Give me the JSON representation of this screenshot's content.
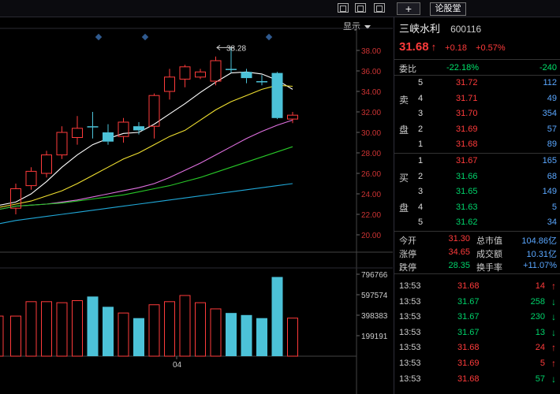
{
  "toolbar": {
    "display_label": "显示",
    "tab_label": "论股堂",
    "plus_label": "+"
  },
  "stock": {
    "name": "三峡水利",
    "code": "600116",
    "price": "31.68",
    "change": "+0.18",
    "change_pct": "+0.57%"
  },
  "weibi": {
    "label": "委比",
    "pct": "-22.18%",
    "diff": "-240"
  },
  "sell": {
    "side_label_top": "卖",
    "side_label_bottom": "盘",
    "rows": [
      {
        "n": "5",
        "price": "31.72",
        "qty": "112"
      },
      {
        "n": "4",
        "price": "31.71",
        "qty": "49"
      },
      {
        "n": "3",
        "price": "31.70",
        "qty": "354"
      },
      {
        "n": "2",
        "price": "31.69",
        "qty": "57"
      },
      {
        "n": "1",
        "price": "31.68",
        "qty": "89"
      }
    ]
  },
  "buy": {
    "side_label_top": "买",
    "side_label_bottom": "盘",
    "rows": [
      {
        "n": "1",
        "price": "31.67",
        "qty": "165"
      },
      {
        "n": "2",
        "price": "31.66",
        "qty": "68"
      },
      {
        "n": "3",
        "price": "31.65",
        "qty": "149"
      },
      {
        "n": "4",
        "price": "31.63",
        "qty": "5"
      },
      {
        "n": "5",
        "price": "31.62",
        "qty": "34"
      }
    ]
  },
  "stats": [
    {
      "k1": "今开",
      "v1": "31.30",
      "k2": "总市值",
      "v2": "104.86亿"
    },
    {
      "k1": "涨停",
      "v1": "34.65",
      "k2": "成交额",
      "v2": "10.31亿"
    },
    {
      "k1": "跌停",
      "v1": "28.35",
      "k2": "换手率",
      "v2": "+11.07%"
    }
  ],
  "ticks": [
    {
      "time": "13:53",
      "price": "31.68",
      "qty": "14",
      "dir": "up"
    },
    {
      "time": "13:53",
      "price": "31.67",
      "qty": "258",
      "dir": "down"
    },
    {
      "time": "13:53",
      "price": "31.67",
      "qty": "230",
      "dir": "down"
    },
    {
      "time": "13:53",
      "price": "31.67",
      "qty": "13",
      "dir": "down"
    },
    {
      "time": "13:53",
      "price": "31.68",
      "qty": "24",
      "dir": "up"
    },
    {
      "time": "13:53",
      "price": "31.69",
      "qty": "5",
      "dir": "up"
    },
    {
      "time": "13:53",
      "price": "31.68",
      "qty": "57",
      "dir": "down"
    }
  ],
  "chart_data": [
    {
      "type": "candlestick",
      "title": "",
      "price_axis_labels": [
        "38.00",
        "36.00",
        "34.00",
        "32.00",
        "30.00",
        "28.00",
        "26.00",
        "24.00",
        "22.00",
        "20.00"
      ],
      "ylim": [
        20,
        38
      ],
      "max_annotation": "38.28",
      "candles": [
        {
          "o": 22.6,
          "c": 24.5,
          "h": 25.0,
          "l": 22.0,
          "color": "red"
        },
        {
          "o": 24.8,
          "c": 26.2,
          "h": 26.6,
          "l": 24.4,
          "color": "red"
        },
        {
          "o": 26.0,
          "c": 27.8,
          "h": 28.2,
          "l": 25.6,
          "color": "red"
        },
        {
          "o": 27.8,
          "c": 30.0,
          "h": 30.6,
          "l": 27.4,
          "color": "red"
        },
        {
          "o": 29.5,
          "c": 30.4,
          "h": 31.6,
          "l": 28.8,
          "color": "red"
        },
        {
          "o": 30.6,
          "c": 30.6,
          "h": 32.0,
          "l": 29.4,
          "color": "cyan"
        },
        {
          "o": 30.0,
          "c": 29.1,
          "h": 30.8,
          "l": 28.8,
          "color": "cyan"
        },
        {
          "o": 29.6,
          "c": 31.0,
          "h": 31.4,
          "l": 29.0,
          "color": "red"
        },
        {
          "o": 30.6,
          "c": 30.2,
          "h": 31.0,
          "l": 29.8,
          "color": "cyan"
        },
        {
          "o": 30.6,
          "c": 33.6,
          "h": 33.8,
          "l": 29.4,
          "color": "red"
        },
        {
          "o": 34.0,
          "c": 35.4,
          "h": 36.2,
          "l": 33.2,
          "color": "red"
        },
        {
          "o": 35.2,
          "c": 36.4,
          "h": 36.6,
          "l": 34.4,
          "color": "red"
        },
        {
          "o": 35.4,
          "c": 35.9,
          "h": 36.2,
          "l": 35.2,
          "color": "red"
        },
        {
          "o": 35.0,
          "c": 37.0,
          "h": 37.4,
          "l": 34.6,
          "color": "red"
        },
        {
          "o": 36.2,
          "c": 36.2,
          "h": 38.28,
          "l": 35.8,
          "color": "cyan"
        },
        {
          "o": 35.9,
          "c": 35.3,
          "h": 36.2,
          "l": 34.8,
          "color": "cyan"
        },
        {
          "o": 35.0,
          "c": 35.0,
          "h": 35.6,
          "l": 34.6,
          "color": "cyan"
        },
        {
          "o": 35.8,
          "c": 31.4,
          "h": 35.9,
          "l": 31.3,
          "color": "cyan"
        },
        {
          "o": 31.3,
          "c": 31.68,
          "h": 32.0,
          "l": 30.9,
          "color": "red"
        }
      ],
      "ma": [
        {
          "name": "MA5",
          "color": "#ffffff",
          "values": [
            23.2,
            24.0,
            25.2,
            26.6,
            27.8,
            28.8,
            29.4,
            29.9,
            30.0,
            30.8,
            31.8,
            32.8,
            33.9,
            34.9,
            35.8,
            35.9,
            35.7,
            35.1,
            34.2
          ]
        },
        {
          "name": "MA10",
          "color": "#f0e030",
          "values": [
            23.0,
            23.3,
            23.8,
            24.3,
            25.0,
            25.8,
            26.6,
            27.4,
            28.0,
            28.8,
            29.6,
            30.2,
            31.2,
            32.2,
            33.0,
            33.6,
            34.2,
            34.6,
            34.5
          ]
        },
        {
          "name": "MA20",
          "color": "#e070e0",
          "values": [
            22.8,
            22.9,
            23.0,
            23.2,
            23.4,
            23.7,
            24.0,
            24.3,
            24.6,
            25.0,
            25.6,
            26.3,
            27.0,
            27.8,
            28.6,
            29.4,
            30.1,
            30.7,
            31.2
          ]
        },
        {
          "name": "MA30",
          "color": "#28c828",
          "values": [
            22.8,
            22.9,
            23.0,
            23.1,
            23.3,
            23.5,
            23.7,
            23.9,
            24.2,
            24.5,
            24.8,
            25.2,
            25.6,
            26.1,
            26.6,
            27.1,
            27.6,
            28.1,
            28.6
          ]
        },
        {
          "name": "MA60",
          "color": "#20a8d8",
          "values": [
            21.4,
            21.6,
            21.8,
            22.0,
            22.2,
            22.4,
            22.6,
            22.8,
            23.0,
            23.2,
            23.4,
            23.6,
            23.8,
            24.0,
            24.2,
            24.4,
            24.6,
            24.8,
            25.0
          ]
        }
      ]
    },
    {
      "type": "bar",
      "title": "",
      "volume_axis_labels": [
        "796766",
        "597574",
        "398383",
        "199191"
      ],
      "ylim": [
        0,
        796766
      ],
      "x_tick": "04",
      "values": [
        390000,
        530000,
        530000,
        520000,
        540000,
        580000,
        480000,
        420000,
        370000,
        500000,
        530000,
        590000,
        520000,
        460000,
        420000,
        400000,
        370000,
        770000,
        370000
      ],
      "colors": [
        "red",
        "red",
        "red",
        "red",
        "red",
        "cyan",
        "cyan",
        "red",
        "cyan",
        "red",
        "red",
        "red",
        "red",
        "red",
        "cyan",
        "cyan",
        "cyan",
        "cyan",
        "red"
      ]
    }
  ]
}
